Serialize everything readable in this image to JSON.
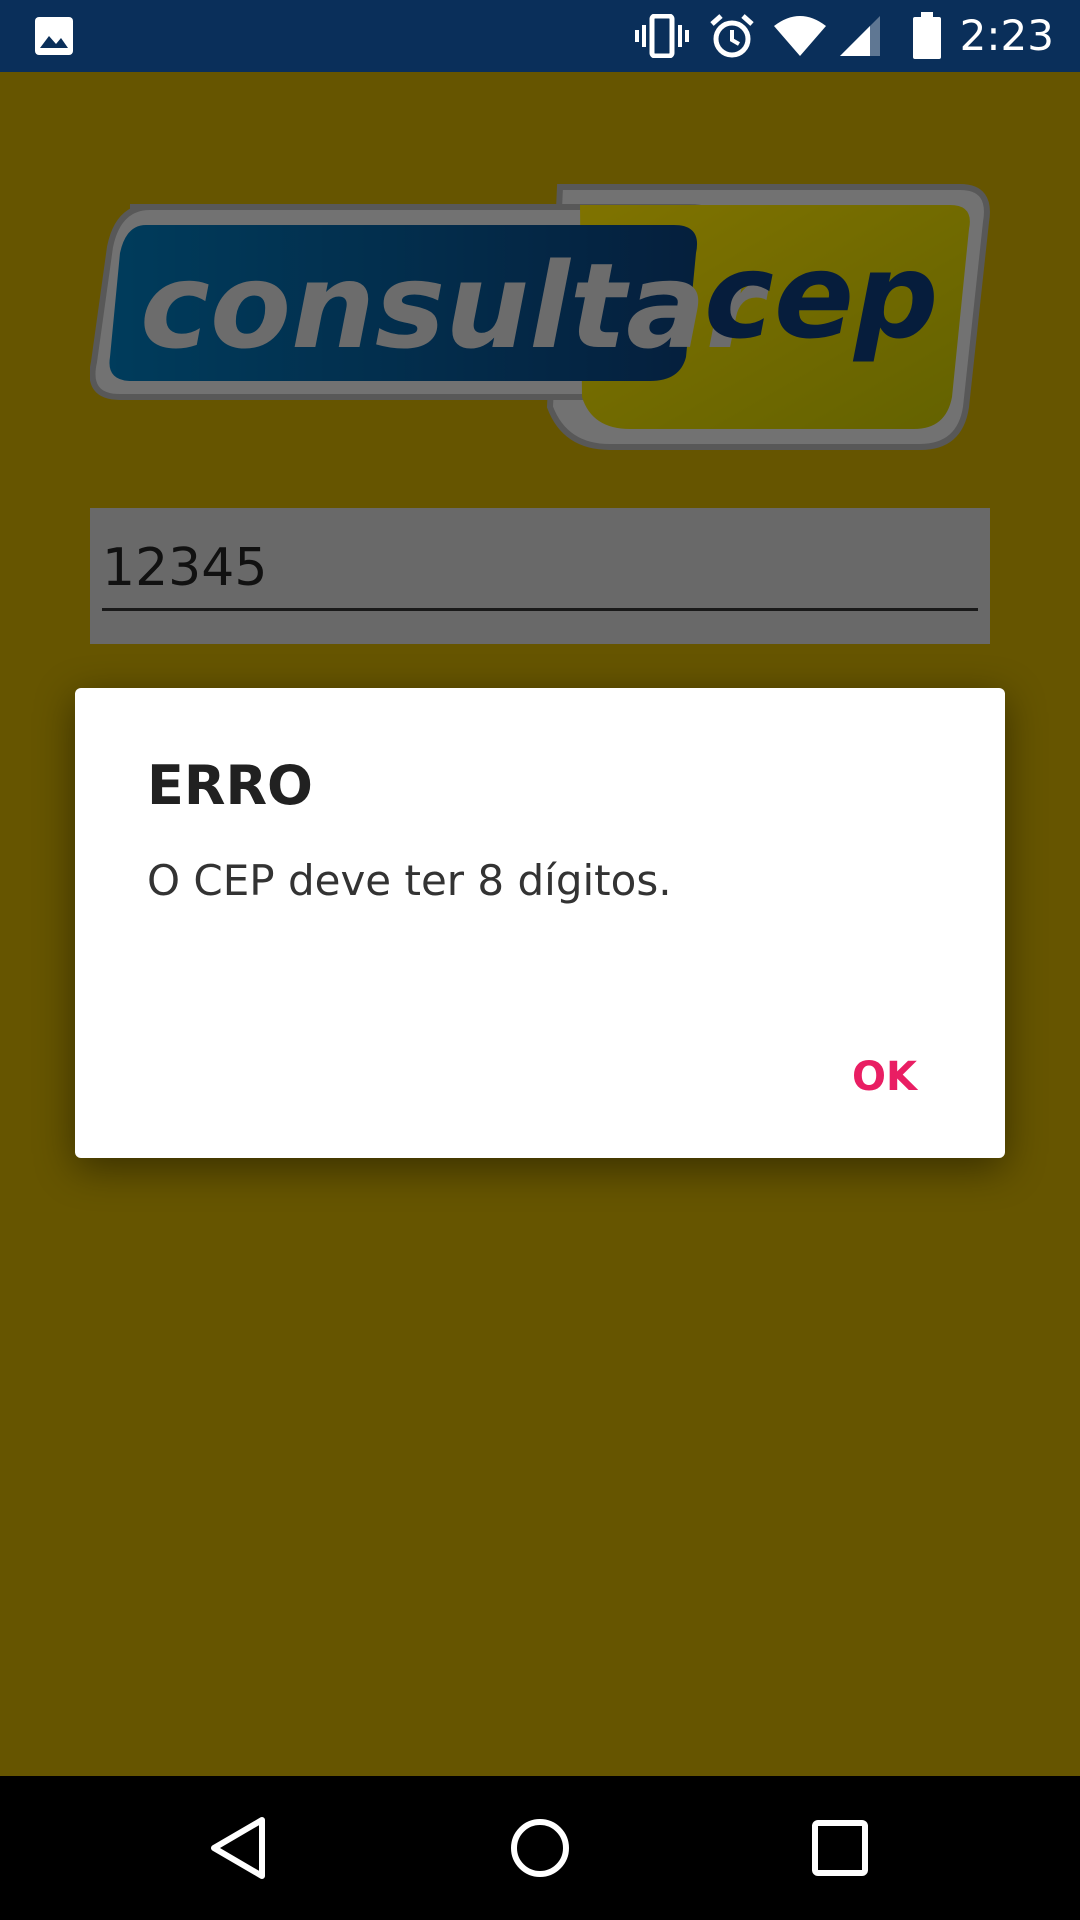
{
  "status_bar": {
    "time": "2:23",
    "icons": [
      "gallery-notification-icon",
      "vibrate-icon",
      "alarm-icon",
      "wifi-icon",
      "cell-signal-icon",
      "battery-icon"
    ]
  },
  "app": {
    "logo": {
      "text_left": "consultar",
      "text_right": "cep"
    },
    "cep_field": {
      "value": "12345"
    }
  },
  "dialog": {
    "title": "ERRO",
    "message": "O CEP deve ter 8 dígitos.",
    "ok_label": "OK"
  },
  "nav_bar": {
    "buttons": [
      "back-icon",
      "home-icon",
      "recents-icon"
    ]
  },
  "colors": {
    "status_bar": "#0a2f5a",
    "app_background": "#ccaa00",
    "accent": "#e91e63"
  }
}
